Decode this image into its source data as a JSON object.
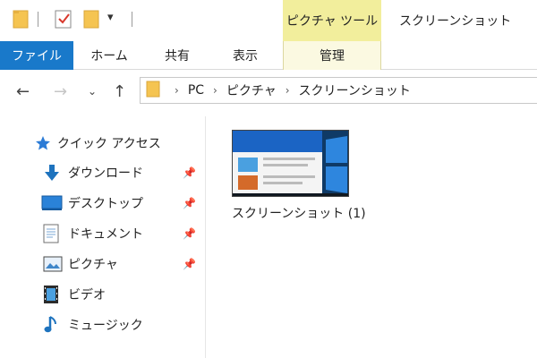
{
  "window": {
    "title": "スクリーンショット"
  },
  "ribbon": {
    "context_group": "ピクチャ ツール",
    "tabs": [
      {
        "label": "ファイル"
      },
      {
        "label": "ホーム"
      },
      {
        "label": "共有"
      },
      {
        "label": "表示"
      },
      {
        "label": "管理"
      }
    ]
  },
  "address": {
    "crumbs": [
      "PC",
      "ピクチャ",
      "スクリーンショット"
    ]
  },
  "nav": {
    "items": [
      {
        "label": "クイック アクセス",
        "icon": "star-icon"
      },
      {
        "label": "ダウンロード",
        "icon": "download-arrow-icon"
      },
      {
        "label": "デスクトップ",
        "icon": "desktop-icon"
      },
      {
        "label": "ドキュメント",
        "icon": "document-icon"
      },
      {
        "label": "ピクチャ",
        "icon": "picture-icon"
      },
      {
        "label": "ビデオ",
        "icon": "film-icon"
      },
      {
        "label": "ミュージック",
        "icon": "music-note-icon"
      }
    ]
  },
  "files": [
    {
      "name": "スクリーンショット (1)"
    }
  ],
  "colors": {
    "file_tab": "#1979ca",
    "context_tab": "#f2ee9c",
    "folder": "#f5c451",
    "accent_blue": "#1e73be"
  }
}
